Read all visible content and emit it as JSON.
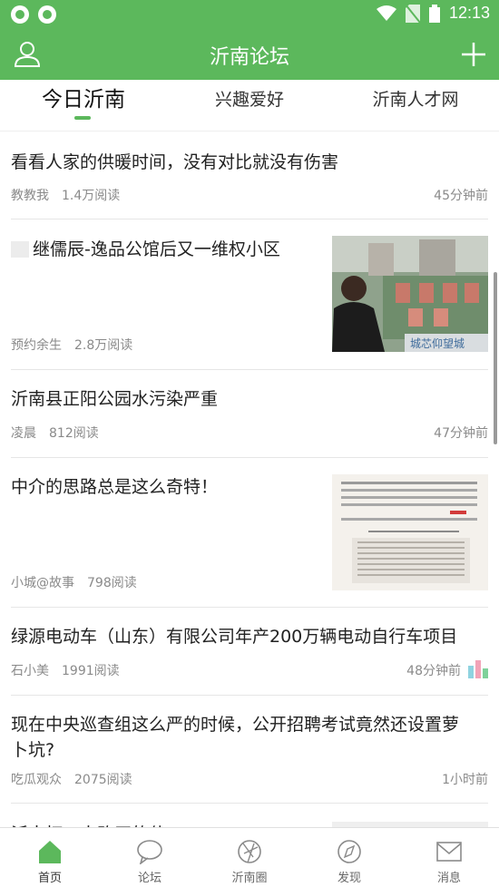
{
  "status_bar": {
    "time": "12:13"
  },
  "app_bar": {
    "title": "沂南论坛"
  },
  "tabs": [
    {
      "label": "今日沂南",
      "active": true
    },
    {
      "label": "兴趣爱好",
      "active": false
    },
    {
      "label": "沂南人才网",
      "active": false
    }
  ],
  "feed": [
    {
      "title": "看看人家的供暖时间，没有对比就没有伤害",
      "author": "教教我",
      "reads": "1.4万阅读",
      "time": "45分钟前"
    },
    {
      "title": "继儒辰-逸品公馆后又一维权小区",
      "author": "预约余生",
      "reads": "2.8万阅读",
      "time": "",
      "thumb_text": "城芯仰望城"
    },
    {
      "title": "沂南县正阳公园水污染严重",
      "author": "凌晨",
      "reads": "812阅读",
      "time": "47分钟前"
    },
    {
      "title": "中介的思路总是这么奇特！",
      "author": "小城@故事",
      "reads": "798阅读",
      "time": ""
    },
    {
      "title": "绿源电动车（山东）有限公司年产200万辆电动自行车项目",
      "author": "石小美",
      "reads": "1991阅读",
      "time": "48分钟前"
    },
    {
      "title_line1": "现在中央巡查组这么严的时候，公开招聘考试竟然还设置萝",
      "title_line2": "卜坑?",
      "author": "吃瓜观众",
      "reads": "2075阅读",
      "time": "1小时前"
    },
    {
      "title": "沂南打工人购买的什",
      "author": "",
      "reads": "",
      "time": ""
    }
  ],
  "bottom_nav": [
    {
      "label": "首页",
      "active": true
    },
    {
      "label": "论坛",
      "active": false
    },
    {
      "label": "沂南圈",
      "active": false
    },
    {
      "label": "发现",
      "active": false
    },
    {
      "label": "消息",
      "active": false
    }
  ],
  "colors": {
    "brand": "#5cb85c",
    "text": "#222222",
    "meta": "#8a8a8a"
  }
}
